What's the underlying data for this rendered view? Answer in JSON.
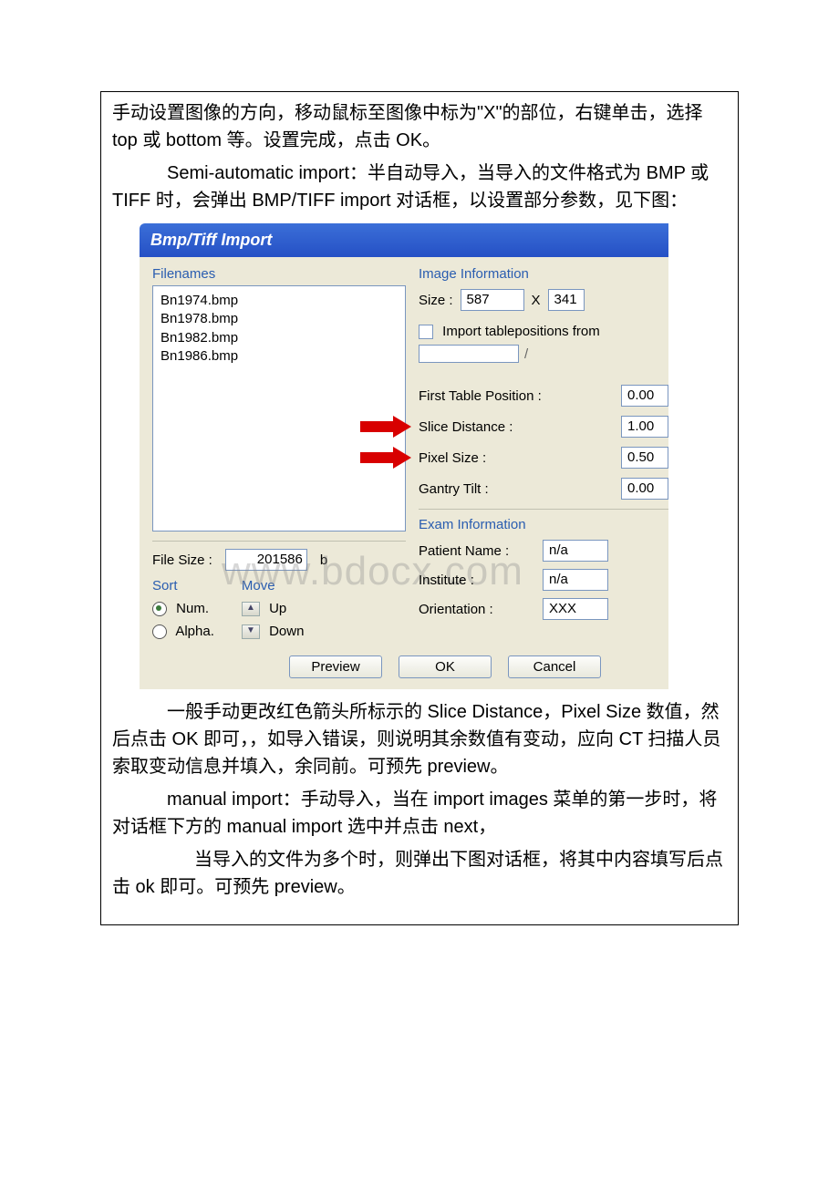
{
  "doc": {
    "p1": "手动设置图像的方向，移动鼠标至图像中标为\"X\"的部位，右键单击，选择 top 或 bottom 等。设置完成，点击 OK。",
    "p2": "Semi-automatic import：半自动导入，当导入的文件格式为 BMP 或 TIFF 时，会弹出 BMP/TIFF import 对话框，以设置部分参数，见下图：",
    "p3": "一般手动更改红色箭头所标示的 Slice Distance，Pixel Size 数值，然后点击 OK 即可，，如导入错误，则说明其余数值有变动，应向 CT 扫描人员索取变动信息并填入，余同前。可预先 preview。",
    "p4": "manual import：手动导入，当在 import images 菜单的第一步时，将对话框下方的 manual import 选中并点击 next，",
    "p5": "当导入的文件为多个时，则弹出下图对话框，将其中内容填写后点击 ok 即可。可预先 preview。"
  },
  "dialog": {
    "title": "Bmp/Tiff Import",
    "filenames_label": "Filenames",
    "files": [
      "Bn1974.bmp",
      "Bn1978.bmp",
      "Bn1982.bmp",
      "Bn1986.bmp"
    ],
    "file_size_label": "File Size :",
    "file_size_value": "201586",
    "file_size_unit": "b",
    "sort_label": "Sort",
    "sort_num": "Num.",
    "sort_alpha": "Alpha.",
    "move_label": "Move",
    "move_up": "Up",
    "move_down": "Down",
    "image_info_label": "Image Information",
    "size_label": "Size :",
    "size_w": "587",
    "size_x": "X",
    "size_h": "341",
    "import_tp_label": "Import tablepositions from",
    "first_tp_label": "First Table Position :",
    "first_tp_val": "0.00",
    "slice_label": "Slice Distance :",
    "slice_val": "1.00",
    "pixel_label": "Pixel Size :",
    "pixel_val": "0.50",
    "gantry_label": "Gantry Tilt :",
    "gantry_val": "0.00",
    "exam_label": "Exam Information",
    "patient_label": "Patient Name :",
    "patient_val": "n/a",
    "institute_label": "Institute :",
    "institute_val": "n/a",
    "orient_label": "Orientation :",
    "orient_val": "XXX",
    "btn_preview": "Preview",
    "btn_ok": "OK",
    "btn_cancel": "Cancel"
  },
  "watermark": "www.bdocx.com"
}
